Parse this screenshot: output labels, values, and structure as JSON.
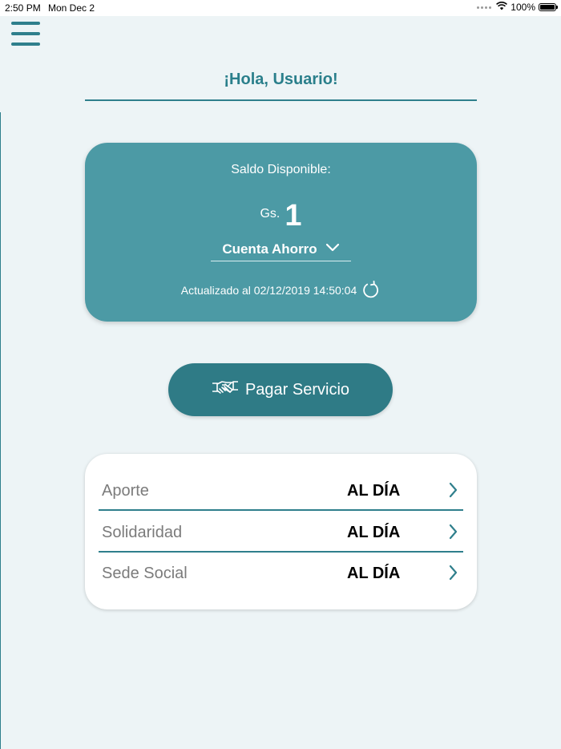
{
  "statusbar": {
    "time": "2:50 PM",
    "date": "Mon Dec 2",
    "battery": "100%"
  },
  "header": {
    "greeting": "¡Hola, Usuario!"
  },
  "balance": {
    "label": "Saldo Disponible:",
    "currency": "Gs.",
    "amount": "1",
    "account": "Cuenta Ahorro",
    "updated": "Actualizado al 02/12/2019 14:50:04"
  },
  "actions": {
    "pay_label": "Pagar Servicio"
  },
  "status_rows": [
    {
      "label": "Aporte",
      "value": "AL DÍA"
    },
    {
      "label": "Solidaridad",
      "value": "AL DÍA"
    },
    {
      "label": "Sede Social",
      "value": "AL DÍA"
    }
  ],
  "colors": {
    "background": "#edf4f6",
    "accent": "#2f7f8c",
    "card": "#4c9aa5",
    "button": "#2f7b86"
  },
  "icons": [
    "menu-icon",
    "wifi-icon",
    "battery-icon",
    "chevron-down-icon",
    "refresh-icon",
    "handshake-icon",
    "chevron-right-icon"
  ]
}
